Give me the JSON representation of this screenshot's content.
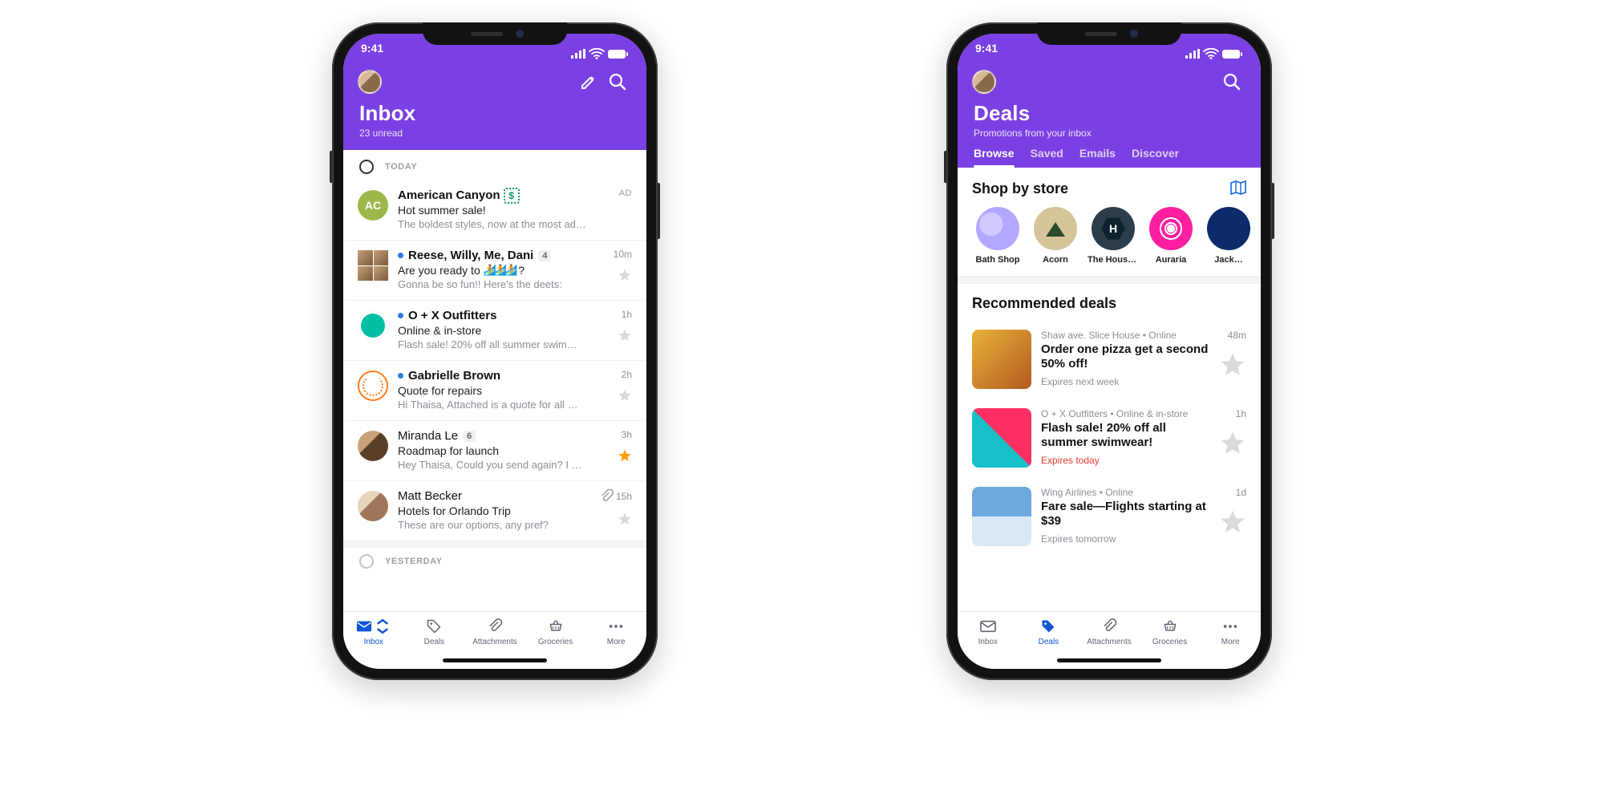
{
  "status": {
    "time": "9:41"
  },
  "colors": {
    "brand": "#7b40e3",
    "accent_blue": "#1354d6",
    "star_on": "#ff9d0a"
  },
  "phone1": {
    "header": {
      "title": "Inbox",
      "subtitle": "23 unread"
    },
    "sections": {
      "today": "TODAY",
      "yesterday": "YESTERDAY"
    },
    "ad": {
      "avatar_initials": "AC",
      "from": "American Canyon",
      "subject": "Hot summer sale!",
      "snippet": "The boldest styles, now at the most adven…",
      "label": "AD"
    },
    "messages": [
      {
        "unread": true,
        "from": "Reese, Willy, Me, Dani",
        "count": "4",
        "subject_prefix": "Are you ready to ",
        "subject_emoji": "🏄🏄🏄",
        "subject_suffix": "?",
        "snippet": "Gonna be so fun!! Here's the deets:",
        "time": "10m",
        "starred": false,
        "avatar": "grid"
      },
      {
        "unread": true,
        "from": "O + X Outfitters",
        "subject": "Online & in-store",
        "snippet": "Flash sale! 20% off all summer swim…",
        "time": "1h",
        "starred": false,
        "avatar": "ox"
      },
      {
        "unread": true,
        "from": "Gabrielle Brown",
        "subject": "Quote for repairs",
        "snippet": "Hi Thaisa, Attached is a quote for all …",
        "time": "2h",
        "starred": false,
        "avatar": "gb"
      },
      {
        "unread": false,
        "from": "Miranda Le",
        "count": "6",
        "subject": "Roadmap for launch",
        "snippet": "Hey Thaisa, Could you send again? I …",
        "time": "3h",
        "starred": true,
        "avatar": "ml"
      },
      {
        "unread": false,
        "from": "Matt Becker",
        "subject": "Hotels for Orlando Trip",
        "snippet": "These are our options, any pref?",
        "time": "15h",
        "clip": true,
        "starred": false,
        "avatar": "mb"
      }
    ],
    "nav": {
      "active": 0
    }
  },
  "phone2": {
    "header": {
      "title": "Deals",
      "subtitle": "Promotions from your inbox"
    },
    "tabs": [
      "Browse",
      "Saved",
      "Emails",
      "Discover"
    ],
    "active_tab": 0,
    "shop_title": "Shop by store",
    "stores": [
      {
        "name": "Bath Shop"
      },
      {
        "name": "Acorn"
      },
      {
        "name": "The Houston"
      },
      {
        "name": "Auraria"
      },
      {
        "name": "Jack…"
      }
    ],
    "rec_title": "Recommended deals",
    "deals": [
      {
        "merchant": "Shaw ave. Slice House • Online",
        "title": "Order one pizza get a second 50% off!",
        "expires": "Expires next week",
        "time": "48m",
        "expired_today": false
      },
      {
        "merchant": "O + X Outfitters • Online & in-store",
        "title": "Flash sale! 20% off all summer swimwear!",
        "expires": "Expires today",
        "time": "1h",
        "expired_today": true
      },
      {
        "merchant": "Wing Airlines • Online",
        "title": "Fare sale—Flights starting at $39",
        "expires": "Expires tomorrow",
        "time": "1d",
        "expired_today": false
      }
    ],
    "nav": {
      "active": 1
    }
  },
  "nav_labels": [
    "Inbox",
    "Deals",
    "Attachments",
    "Groceries",
    "More"
  ]
}
